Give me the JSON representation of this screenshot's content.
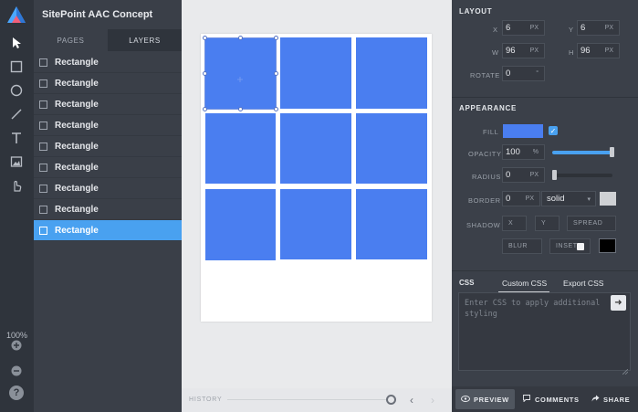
{
  "app": {
    "project_title": "SitePoint AAC Concept"
  },
  "tabs": [
    {
      "label": "PAGES",
      "active": false
    },
    {
      "label": "LAYERS",
      "active": true
    }
  ],
  "layers": [
    {
      "label": "Rectangle",
      "selected": false
    },
    {
      "label": "Rectangle",
      "selected": false
    },
    {
      "label": "Rectangle",
      "selected": false
    },
    {
      "label": "Rectangle",
      "selected": false
    },
    {
      "label": "Rectangle",
      "selected": false
    },
    {
      "label": "Rectangle",
      "selected": false
    },
    {
      "label": "Rectangle",
      "selected": false
    },
    {
      "label": "Rectangle",
      "selected": false
    },
    {
      "label": "Rectangle",
      "selected": true
    }
  ],
  "toolbar": {
    "tools": [
      "select-arrow-icon",
      "rectangle-icon",
      "circle-icon",
      "line-icon",
      "text-icon",
      "image-icon",
      "hand-pointer-icon"
    ],
    "zoom_label": "100%",
    "help": "?"
  },
  "history": {
    "label": "HISTORY"
  },
  "layout": {
    "title": "LAYOUT",
    "x_label": "X",
    "x_value": "6",
    "x_unit": "PX",
    "y_label": "Y",
    "y_value": "6",
    "y_unit": "PX",
    "w_label": "W",
    "w_value": "96",
    "w_unit": "PX",
    "h_label": "H",
    "h_value": "96",
    "h_unit": "PX",
    "rotate_label": "ROTATE",
    "rotate_value": "0",
    "rotate_unit": "°"
  },
  "appearance": {
    "title": "APPEARANCE",
    "fill_label": "FILL",
    "fill_color": "#4a7ef0",
    "fill_enabled": true,
    "opacity_label": "OPACITY",
    "opacity_value": "100",
    "opacity_unit": "%",
    "opacity_level": 1.0,
    "radius_label": "RADIUS",
    "radius_value": "0",
    "radius_unit": "PX",
    "radius_level": 0.0,
    "border_label": "BORDER",
    "border_value": "0",
    "border_unit": "PX",
    "border_style": "solid",
    "border_color": "#cfd1d4",
    "shadow_label": "SHADOW",
    "shadow_x": "X",
    "shadow_y": "Y",
    "shadow_spread": "SPREAD",
    "shadow_blur": "BLUR",
    "shadow_inset": "INSET",
    "shadow_color": "#000000"
  },
  "css": {
    "label": "CSS",
    "custom_tab": "Custom CSS",
    "export_tab": "Export CSS",
    "placeholder": "Enter CSS to apply additional styling"
  },
  "bottom": {
    "preview": "PREVIEW",
    "comments": "COMMENTS",
    "share": "SHARE"
  },
  "colors": {
    "accent": "#49a1f0",
    "rect_blue": "#4a7ef0"
  }
}
